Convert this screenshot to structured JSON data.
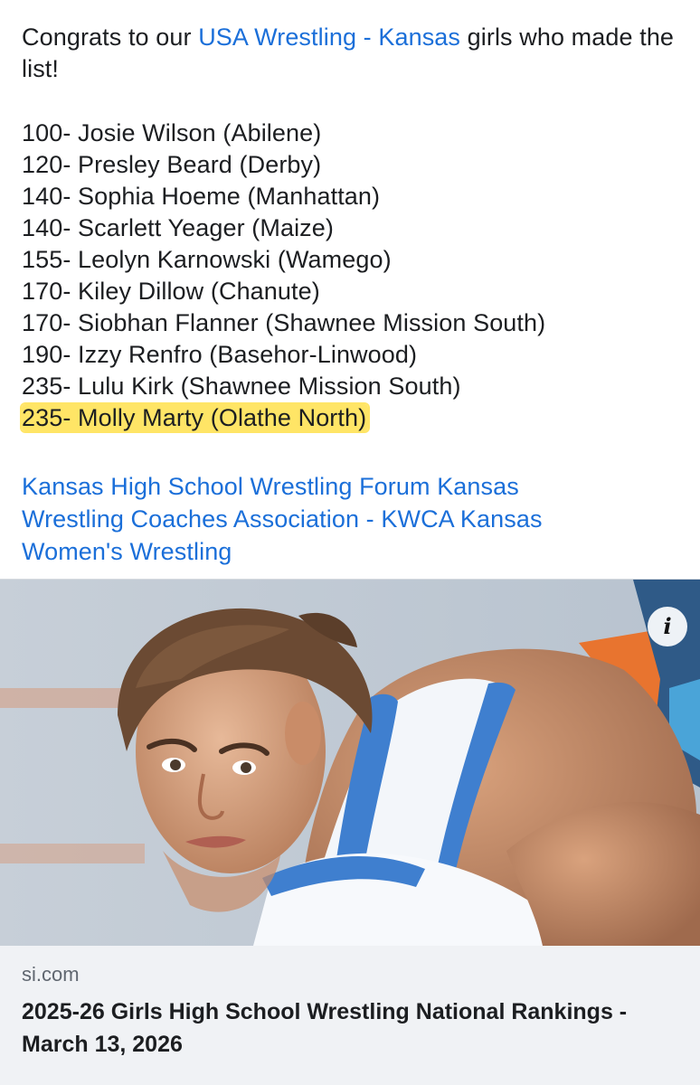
{
  "post": {
    "intro_prefix": "Congrats to our ",
    "intro_link": "USA Wrestling - Kansas",
    "intro_suffix": " girls who made the list!",
    "roster": [
      "100- Josie Wilson (Abilene)",
      "120- Presley Beard (Derby)",
      "140- Sophia Hoeme (Manhattan)",
      "140- Scarlett Yeager (Maize)",
      "155- Leolyn Karnowski (Wamego)",
      "170- Kiley Dillow (Chanute)",
      "170- Siobhan Flanner (Shawnee Mission South)",
      "190- Izzy Renfro (Basehor-Linwood)",
      "235- Lulu Kirk (Shawnee Mission South)",
      "235- Molly Marty (Olathe North)"
    ],
    "tags": [
      "Kansas High School Wrestling Forum",
      "Kansas Wrestling Coaches Association - KWCA",
      "Kansas Women's Wrestling"
    ]
  },
  "link_card": {
    "info_icon": "info-icon",
    "info_glyph": "i",
    "domain": "si.com",
    "headline": "2025-26 Girls High School Wrestling National Rankings - March 13, 2026"
  },
  "colors": {
    "link": "#1b6fd9",
    "highlight": "#ffe566",
    "card_bg": "#f0f2f5"
  }
}
